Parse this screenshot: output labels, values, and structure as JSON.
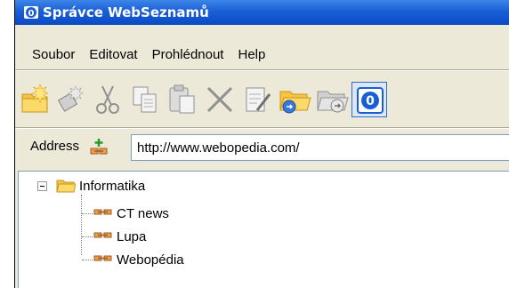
{
  "window": {
    "title": "Správce WebSeznamů"
  },
  "menu": [
    "Soubor",
    "Editovat",
    "Prohlédnout",
    "Help"
  ],
  "toolbar": {
    "buttons": [
      {
        "name": "new-folder-icon"
      },
      {
        "name": "new-link-icon"
      },
      {
        "name": "cut-icon"
      },
      {
        "name": "copy-icon"
      },
      {
        "name": "paste-icon"
      },
      {
        "name": "delete-icon"
      },
      {
        "name": "properties-icon"
      },
      {
        "name": "open-folder-icon"
      },
      {
        "name": "open-folder-gray-icon"
      },
      {
        "name": "info-icon"
      }
    ]
  },
  "address": {
    "label": "Address",
    "value": "http://www.webopedia.com/"
  },
  "tree": {
    "root": {
      "label": "Informatika",
      "expanded": true
    },
    "children": [
      {
        "label": "CT news"
      },
      {
        "label": "Lupa"
      },
      {
        "label": "Webopédia"
      }
    ]
  },
  "colors": {
    "titlebar": "#0a4bc4",
    "chrome": "#ece9d8",
    "link_icon": "#c8702a",
    "folder": "#f5c542"
  }
}
